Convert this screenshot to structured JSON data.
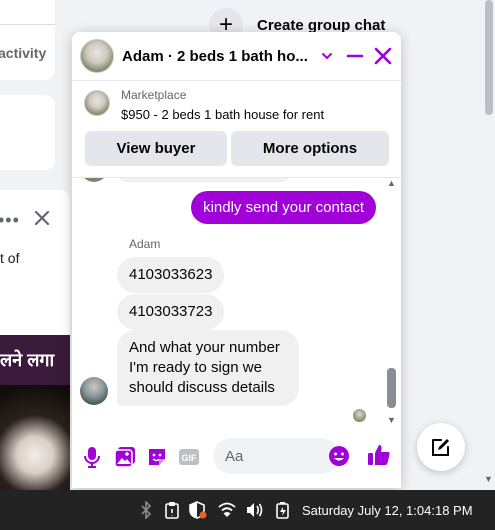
{
  "background": {
    "sidebar_text": "activity",
    "post_snippet": "t of",
    "banner_text": "लने लगा",
    "create_group_label": "Create group chat"
  },
  "chat": {
    "title": "Adam · 2 beds 1 bath house for rent",
    "title_display": "Adam · 2 beds 1 bath ho...",
    "marketplace_label": "Marketplace",
    "listing": "$950 - 2 beds 1 bath house for rent",
    "view_buyer_label": "View buyer",
    "more_options_label": "More options",
    "accent_color": "#a100d9",
    "messages": [
      {
        "direction": "outgoing",
        "text": "kindly send your contact"
      },
      {
        "direction": "incoming",
        "sender": "Adam",
        "text": "4103033623"
      },
      {
        "direction": "incoming",
        "sender": "Adam",
        "text": "4103033723"
      },
      {
        "direction": "incoming",
        "sender": "Adam",
        "text": "And what your number I'm ready to sign we should discuss details"
      }
    ],
    "sender_name": "Adam",
    "input_placeholder": "Aa",
    "composer_icons": [
      "microphone-icon",
      "photo-icon",
      "sticker-icon",
      "gif-icon",
      "emoji-icon",
      "thumbs-up-icon"
    ]
  },
  "taskbar": {
    "clock": "Saturday July 12, 1:04:18 PM",
    "tray_icons": [
      "bluetooth-icon",
      "clipboard-icon",
      "shield-icon",
      "wifi-icon",
      "volume-icon",
      "battery-icon"
    ]
  }
}
